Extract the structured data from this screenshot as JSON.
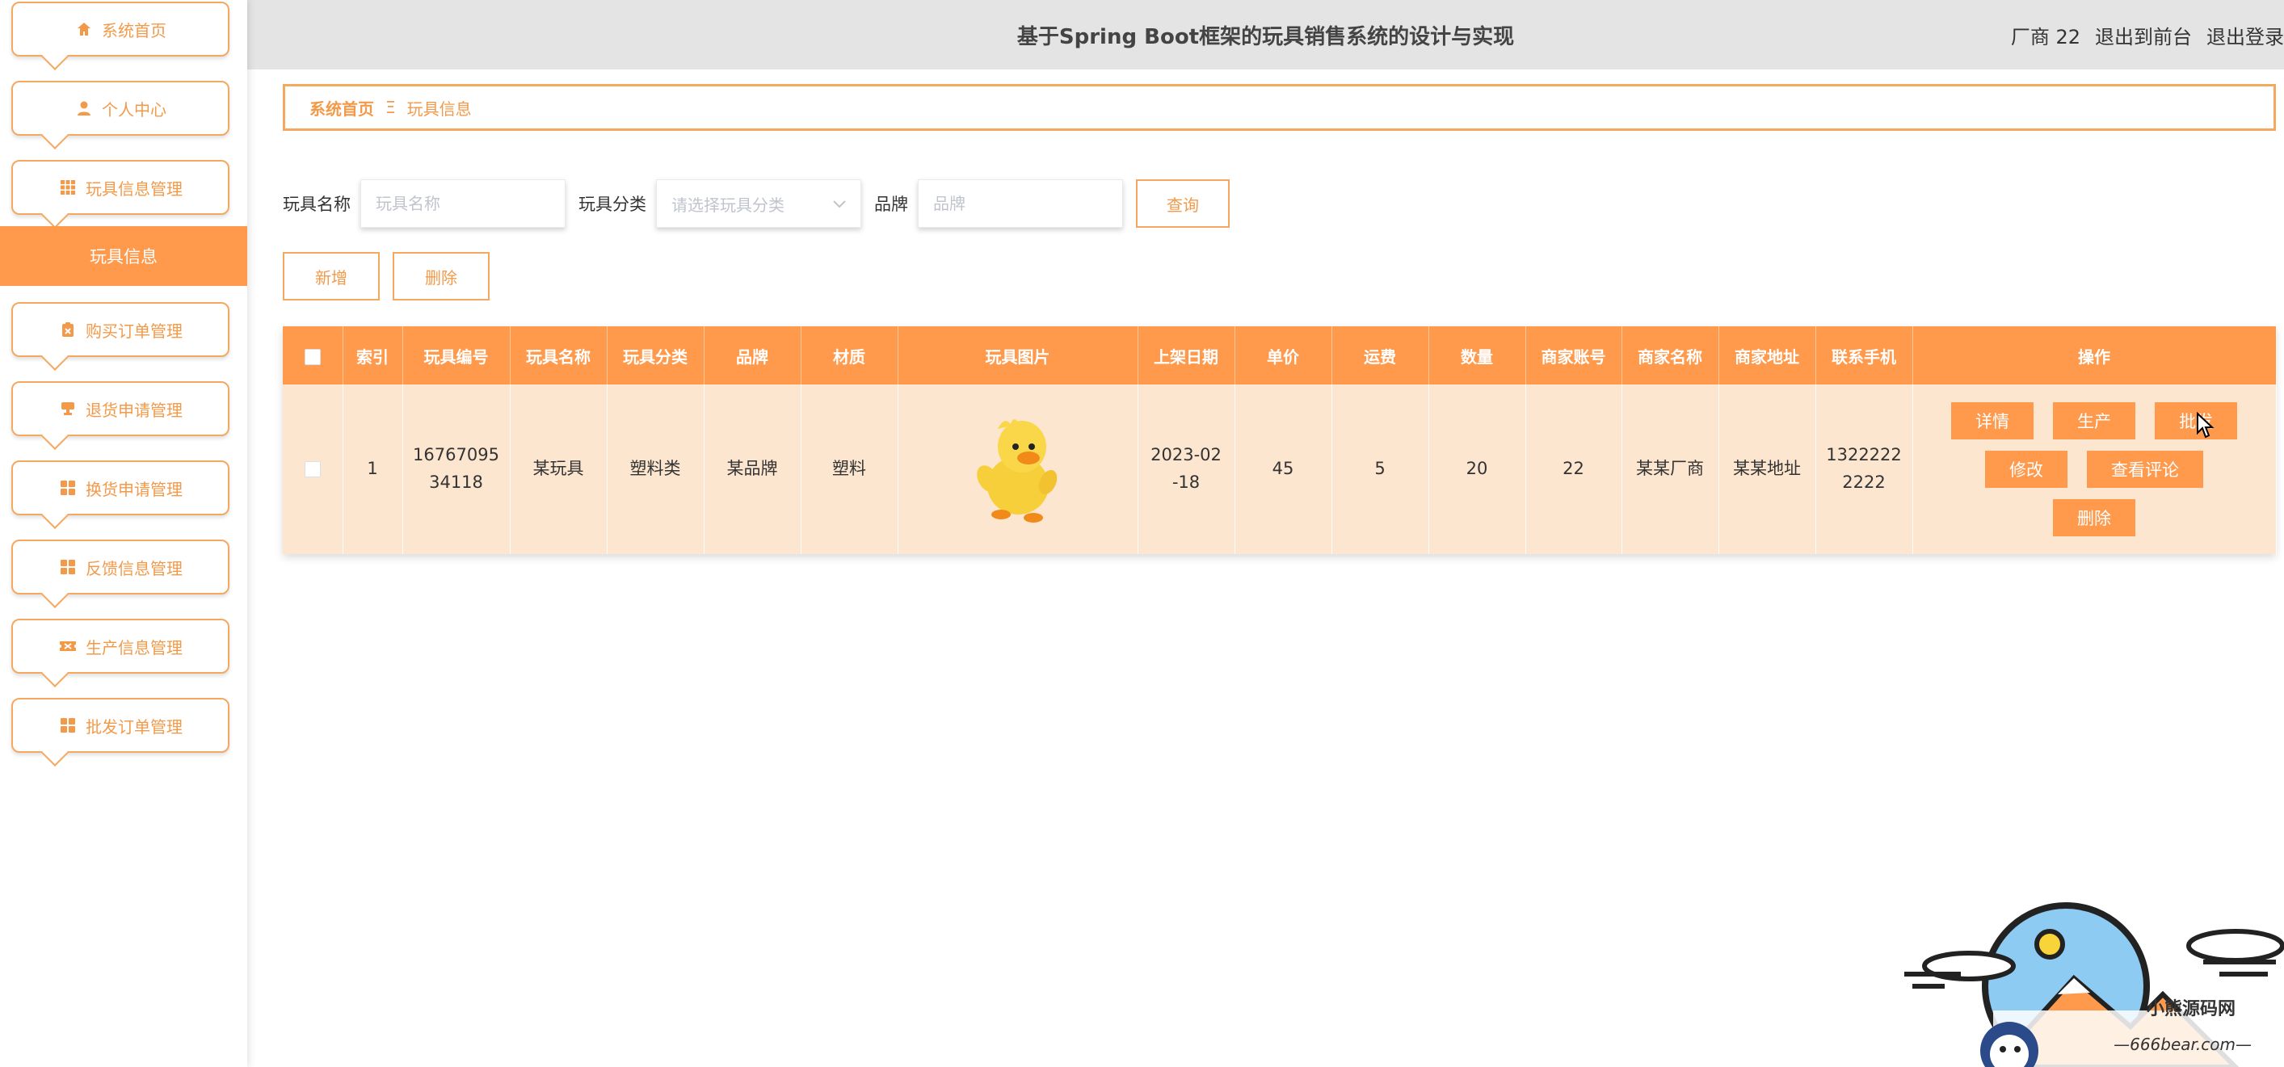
{
  "app": {
    "title": "基于Spring Boot框架的玩具销售系统的设计与实现"
  },
  "header": {
    "user": "厂商 22",
    "to_front": "退出到前台",
    "logout": "退出登录"
  },
  "sidebar": {
    "items": [
      {
        "label": "系统首页",
        "icon": "home-icon"
      },
      {
        "label": "个人中心",
        "icon": "user-icon"
      },
      {
        "label": "玩具信息管理",
        "icon": "grid-icon"
      },
      {
        "label": "玩具信息",
        "icon": ""
      },
      {
        "label": "购买订单管理",
        "icon": "clipboard-icon"
      },
      {
        "label": "退货申请管理",
        "icon": "stamp-icon"
      },
      {
        "label": "换货申请管理",
        "icon": "grid-icon"
      },
      {
        "label": "反馈信息管理",
        "icon": "grid-icon"
      },
      {
        "label": "生产信息管理",
        "icon": "ticket-icon"
      },
      {
        "label": "批发订单管理",
        "icon": "grid-icon"
      }
    ]
  },
  "breadcrumb": {
    "home": "系统首页",
    "separator": "Ξ",
    "current": "玩具信息"
  },
  "search": {
    "name_label": "玩具名称",
    "name_placeholder": "玩具名称",
    "category_label": "玩具分类",
    "category_placeholder": "请选择玩具分类",
    "brand_label": "品牌",
    "brand_placeholder": "品牌",
    "query_button": "查询"
  },
  "actions": {
    "add": "新增",
    "delete": "删除"
  },
  "table": {
    "headers": [
      "",
      "索引",
      "玩具编号",
      "玩具名称",
      "玩具分类",
      "品牌",
      "材质",
      "玩具图片",
      "上架日期",
      "单价",
      "运费",
      "数量",
      "商家账号",
      "商家名称",
      "商家地址",
      "联系手机",
      "操作"
    ],
    "rows": [
      {
        "index": "1",
        "code_line1": "16767095",
        "code_line2": "34118",
        "name": "某玩具",
        "category": "塑料类",
        "brand": "某品牌",
        "material": "塑料",
        "image": "yellow-duck-image",
        "date_line1": "2023-02",
        "date_line2": "-18",
        "price": "45",
        "shipping": "5",
        "quantity": "20",
        "merchant_account": "22",
        "merchant_name": "某某厂商",
        "merchant_address": "某某地址",
        "phone_line1": "1322222",
        "phone_line2": "2222",
        "ops": {
          "detail": "详情",
          "produce": "生产",
          "wholesale": "批发",
          "edit": "修改",
          "comments": "查看评论",
          "delete": "删除"
        }
      }
    ]
  },
  "watermark": {
    "text": "小熊源码网",
    "url": "—666bear.com—"
  },
  "colors": {
    "accent": "#ff9a4d",
    "accent_text": "#f29a4a",
    "header_bg": "#e4e4e4",
    "row_bg": "#fde6cf"
  }
}
